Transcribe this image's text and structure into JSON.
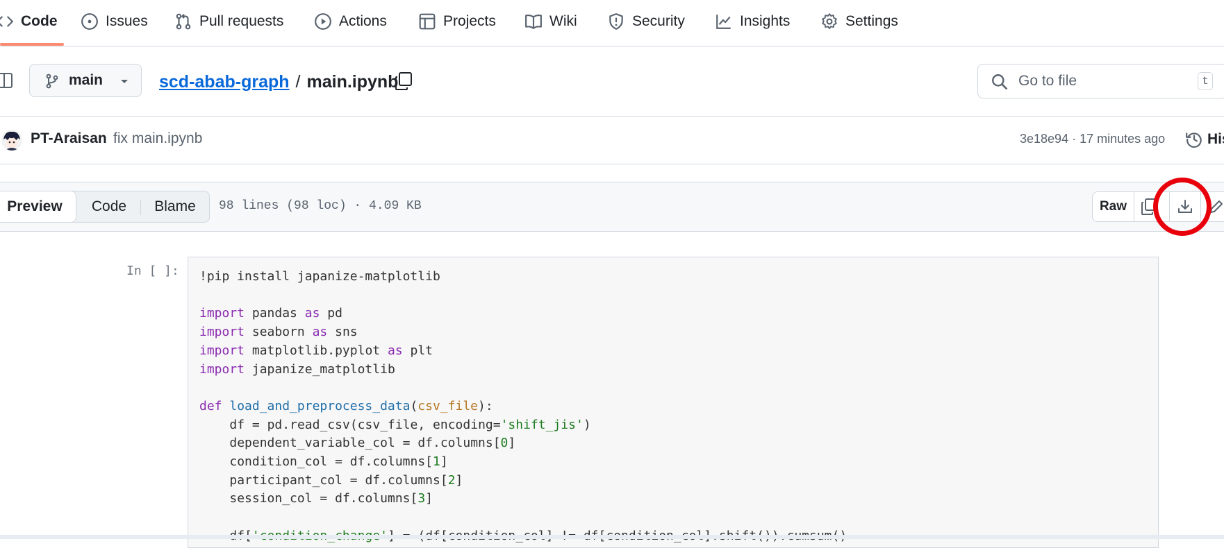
{
  "nav": {
    "tabs": [
      {
        "label": "Code",
        "icon": "code-icon",
        "selected": true
      },
      {
        "label": "Issues",
        "icon": "issue-opened-icon"
      },
      {
        "label": "Pull requests",
        "icon": "git-pull-request-icon"
      },
      {
        "label": "Actions",
        "icon": "play-icon"
      },
      {
        "label": "Projects",
        "icon": "table-icon"
      },
      {
        "label": "Wiki",
        "icon": "book-icon"
      },
      {
        "label": "Security",
        "icon": "shield-icon"
      },
      {
        "label": "Insights",
        "icon": "graph-icon"
      },
      {
        "label": "Settings",
        "icon": "gear-icon"
      }
    ]
  },
  "branch": {
    "name": "main"
  },
  "breadcrumb": {
    "repo": "scd-abab-graph",
    "separator": "/",
    "file": "main.ipynb"
  },
  "search": {
    "placeholder": "Go to file",
    "shortcut": "t"
  },
  "commit": {
    "author": "PT-Araisan",
    "message": "fix main.ipynb",
    "meta": "3e18e94 · 17 minutes ago",
    "history_label": "His"
  },
  "file_header": {
    "views": [
      "Preview",
      "Code",
      "Blame"
    ],
    "active_view": "Preview",
    "info": "98 lines (98 loc) · 4.09 KB",
    "raw_label": "Raw"
  },
  "notebook": {
    "prompt": "In [ ]:",
    "code_lines": [
      "!pip install japanize-matplotlib",
      "",
      "import pandas as pd",
      "import seaborn as sns",
      "import matplotlib.pyplot as plt",
      "import japanize_matplotlib",
      "",
      "def load_and_preprocess_data(csv_file):",
      "    df = pd.read_csv(csv_file, encoding='shift_jis')",
      "    dependent_variable_col = df.columns[0]",
      "    condition_col = df.columns[1]",
      "    participant_col = df.columns[2]",
      "    session_col = df.columns[3]",
      "",
      "    df['condition_change'] = (df[condition_col] != df[condition_col].shift()).cumsum()"
    ]
  },
  "colors": {
    "accent_underline": "#fd8c73",
    "link": "#0969da",
    "annotation": "#e8000b",
    "keyword": "#8a2bb0",
    "function": "#1f6ea8",
    "string": "#1d7b1d"
  }
}
